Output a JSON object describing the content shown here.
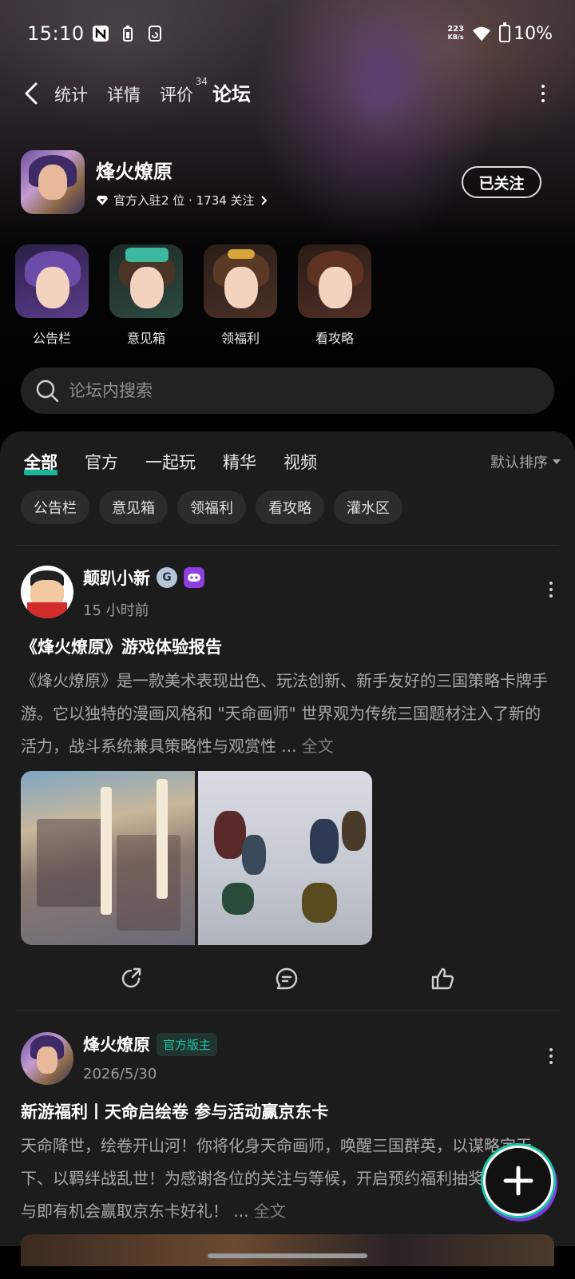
{
  "status_bar": {
    "time": "15:10",
    "net_speed_value": "223",
    "net_speed_unit": "KB/s",
    "battery": "10%"
  },
  "nav": {
    "tabs": [
      {
        "label": "统计"
      },
      {
        "label": "详情"
      },
      {
        "label": "评价",
        "badge": "34"
      },
      {
        "label": "论坛"
      }
    ]
  },
  "game": {
    "title": "烽火燎原",
    "subtitle": "官方入驻2 位 · 1734 关注",
    "follow_label": "已关注"
  },
  "quick_entries": [
    {
      "label": "公告栏"
    },
    {
      "label": "意见箱"
    },
    {
      "label": "领福利"
    },
    {
      "label": "看攻略"
    }
  ],
  "search": {
    "placeholder": "论坛内搜索"
  },
  "feed": {
    "tabs": [
      "全部",
      "官方",
      "一起玩",
      "精华",
      "视频"
    ],
    "sort_label": "默认排序",
    "chips": [
      "公告栏",
      "意见箱",
      "领福利",
      "看攻略",
      "灌水区"
    ]
  },
  "posts": [
    {
      "author": "颠趴小新",
      "time": "15 小时前",
      "title": "《烽火燎原》游戏体验报告",
      "body": "《烽火燎原》是一款美术表现出色、玩法创新、新手友好的三国策略卡牌手游。它以独特的漫画风格和 \"天命画师\" 世界观为传统三国题材注入了新的活力，战斗系统兼具策略性与观赏性 ...",
      "full_label": "全文",
      "badge_letter": "G"
    },
    {
      "author": "烽火燎原",
      "tag": "官方版主",
      "time": "2026/5/30",
      "title": "新游福利丨天命启绘卷 参与活动赢京东卡",
      "body": "天命降世，绘卷开山河！你将化身天命画师，唤醒三国群英，以谋略定天下、以羁绊战乱世！为感谢各位的关注与等候，开启预约福利抽奖活动，参与即有机会赢取京东卡好礼！ ...",
      "full_label": "全文"
    }
  ],
  "colors": {
    "accent": "#18c7a8",
    "panel_bg": "#1c1c1c",
    "muted_text": "#a8a8a8"
  }
}
